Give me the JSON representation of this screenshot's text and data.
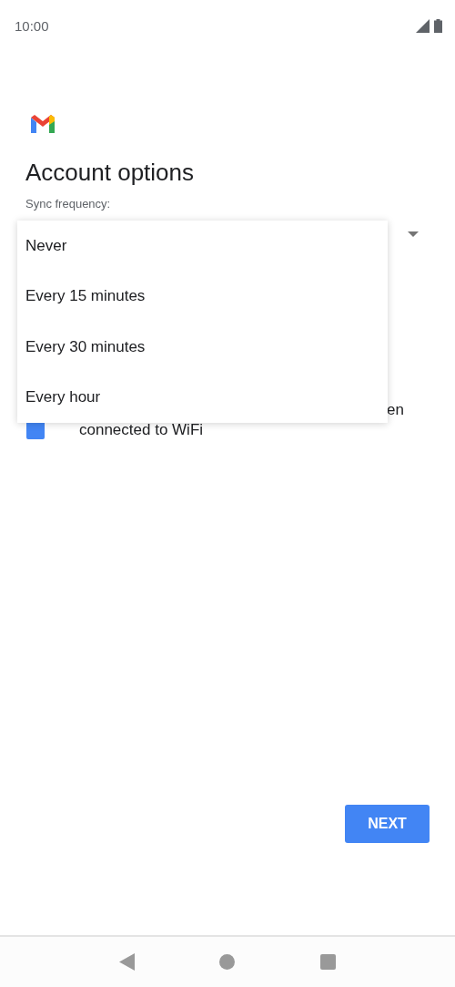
{
  "status_bar": {
    "time": "10:00"
  },
  "title": "Account options",
  "sync_frequency": {
    "label": "Sync frequency:"
  },
  "wifi_option": {
    "checked": true,
    "line_1": "en",
    "line_2": "connected to WiFi"
  },
  "dropdown_menu": {
    "items": [
      "Never",
      "Every 15 minutes",
      "Every 30 minutes",
      "Every hour"
    ]
  },
  "next_button": "NEXT"
}
